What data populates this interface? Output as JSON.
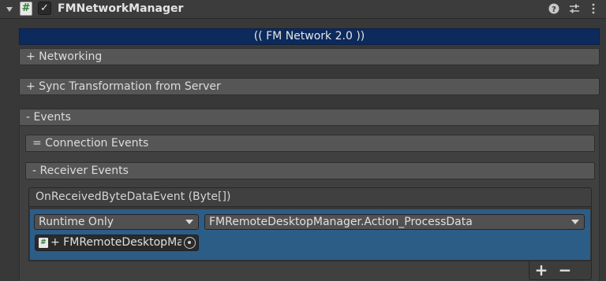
{
  "component": {
    "title": "FMNetworkManager",
    "script_icon_glyph": "#",
    "enabled_glyph": "✓",
    "icons": [
      "help-icon",
      "presets-icon",
      "more-icon"
    ]
  },
  "banner": {
    "text": "(( FM Network 2.0 ))",
    "color": "#0c2a5c"
  },
  "sections": {
    "networking": "+ Networking",
    "sync": "+ Sync Transformation from Server",
    "events": "- Events",
    "connection_events": "= Connection Events",
    "receiver_events": "- Receiver Events"
  },
  "event": {
    "header": "OnReceivedByteDataEvent (Byte[])",
    "runtime_select": "Runtime Only",
    "function_select": "FMRemoteDesktopManager.Action_ProcessData",
    "object_field": "+ FMRemoteDesktopManager (FMRemoteDesktopManager)",
    "selected_color": "#2c5d87"
  },
  "footer": {
    "add_label": "+",
    "remove_label": "−"
  }
}
